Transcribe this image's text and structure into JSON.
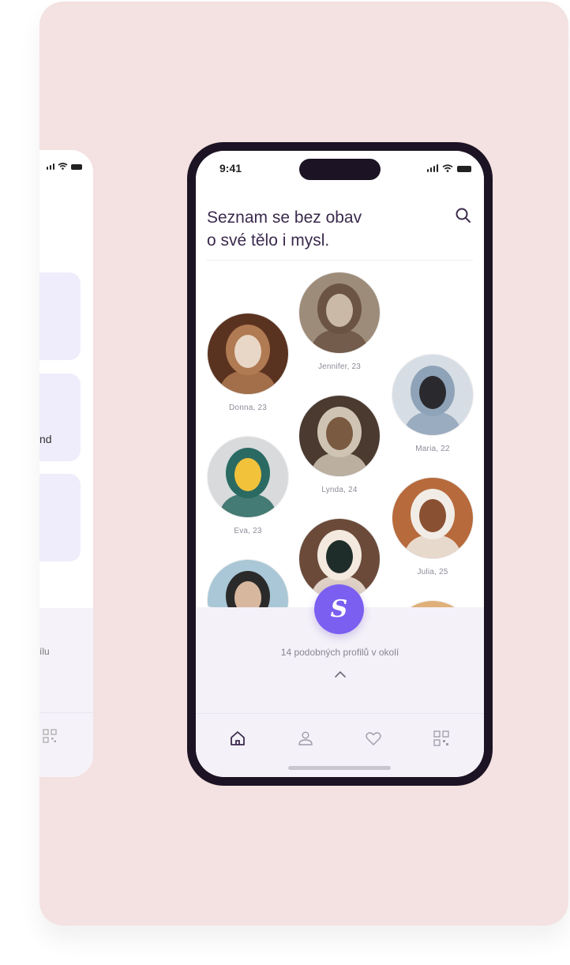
{
  "status": {
    "time": "9:41"
  },
  "header": {
    "title_line1": "Seznam se bez obav",
    "title_line2": "o své tělo i mysl."
  },
  "profiles": [
    {
      "name": "Jennifer, 23",
      "colors": [
        "#9e8c7a",
        "#6b5444",
        "#c9b9a6"
      ]
    },
    {
      "name": "Donna, 23",
      "colors": [
        "#5a3320",
        "#b07a52",
        "#e8d7c6"
      ]
    },
    {
      "name": "Maria, 22",
      "colors": [
        "#d7dde4",
        "#8fa3b8",
        "#2a2a2e"
      ]
    },
    {
      "name": "Lynda, 24",
      "colors": [
        "#4a3a30",
        "#cfc4b4",
        "#7a5a40"
      ]
    },
    {
      "name": "Eva, 23",
      "colors": [
        "#d8dadc",
        "#2a6a62",
        "#f2c23b"
      ]
    },
    {
      "name": "Julia, 25",
      "colors": [
        "#b76a3c",
        "#f1ece6",
        "#8a5032"
      ]
    },
    {
      "name": "",
      "colors": [
        "#6b4a3a",
        "#f3e9de",
        "#1f2d2a"
      ]
    },
    {
      "name": "",
      "colors": [
        "#a9c7d6",
        "#2a2a2a",
        "#d7b79e"
      ]
    },
    {
      "name": "",
      "colors": [
        "#e0b07a",
        "#c28a5a",
        "#f4e3d0"
      ]
    }
  ],
  "sheet": {
    "logo_letter": "S",
    "count_text": "14 podobných profilů v okolí"
  },
  "nav": {
    "items": [
      "home-icon",
      "profile-icon",
      "heart-icon",
      "qr-icon"
    ]
  },
  "left_phone": {
    "partial_text": "nd",
    "partial_footer": "ílu"
  },
  "colors": {
    "background_card": "#f4e1e1",
    "phone_frame": "#1c1424",
    "accent": "#7a5ff0",
    "title": "#3b2a4d",
    "sheet": "#f4f1f8"
  }
}
